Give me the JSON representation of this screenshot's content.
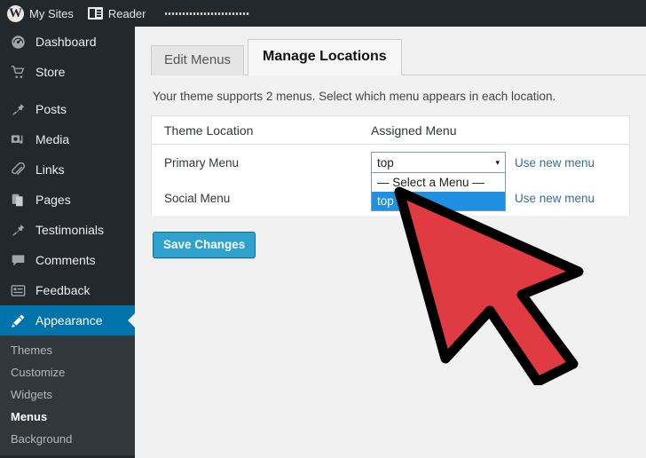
{
  "adminbar": {
    "logo_icon": "wordpress-logo-icon",
    "my_sites_label": "My Sites",
    "reader_icon": "reader-icon",
    "reader_label": "Reader",
    "redacted_site_name": ""
  },
  "sidebar": {
    "items": [
      {
        "label": "Dashboard",
        "icon": "dashboard-icon",
        "active": false
      },
      {
        "label": "Store",
        "icon": "cart-icon",
        "active": false
      },
      {
        "label": "Posts",
        "icon": "pin-icon",
        "active": false
      },
      {
        "label": "Media",
        "icon": "media-icon",
        "active": false
      },
      {
        "label": "Links",
        "icon": "paperclip-icon",
        "active": false
      },
      {
        "label": "Pages",
        "icon": "pages-icon",
        "active": false
      },
      {
        "label": "Testimonials",
        "icon": "pin-icon",
        "active": false
      },
      {
        "label": "Comments",
        "icon": "comment-icon",
        "active": false
      },
      {
        "label": "Feedback",
        "icon": "feedback-icon",
        "active": false
      },
      {
        "label": "Appearance",
        "icon": "paintbrush-icon",
        "active": true
      }
    ],
    "submenu": [
      {
        "label": "Themes",
        "current": false
      },
      {
        "label": "Customize",
        "current": false
      },
      {
        "label": "Widgets",
        "current": false
      },
      {
        "label": "Menus",
        "current": true
      },
      {
        "label": "Background",
        "current": false
      }
    ],
    "active_color": "#0073aa",
    "background_color": "#23282d"
  },
  "content": {
    "tabs": [
      {
        "label": "Edit Menus",
        "active": false
      },
      {
        "label": "Manage Locations",
        "active": true
      }
    ],
    "description": "Your theme supports 2 menus. Select which menu appears in each location.",
    "table": {
      "headers": [
        "Theme Location",
        "Assigned Menu"
      ],
      "rows": [
        {
          "location": "Primary Menu",
          "selected_menu": "top",
          "use_new_label": "Use new menu"
        },
        {
          "location": "Social Menu",
          "selected_menu": "",
          "use_new_label": "Use new menu"
        }
      ]
    },
    "dropdown": {
      "open": true,
      "selected": "top",
      "arrow_glyph": "▾",
      "options": [
        {
          "label": "— Select a Menu —",
          "highlighted": false
        },
        {
          "label": "top",
          "highlighted": true
        }
      ]
    },
    "save_button_label": "Save Changes",
    "accent_color": "#2ea2cc",
    "highlight_color": "#1e8fe1"
  },
  "cursor": {
    "name": "mouse-pointer-arrow",
    "fill_color": "#e03a42",
    "outline_color": "#000000"
  }
}
